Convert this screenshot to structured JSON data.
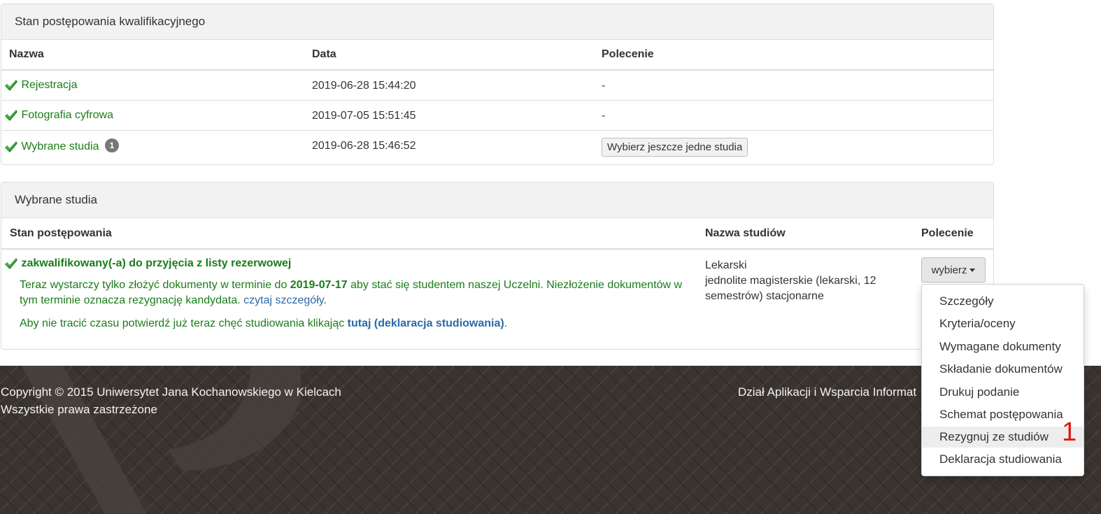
{
  "panel1": {
    "title": "Stan postępowania kwalifikacyjnego",
    "headers": {
      "name": "Nazwa",
      "date": "Data",
      "command": "Polecenie"
    },
    "rows": [
      {
        "name": "Rejestracja",
        "date": "2019-06-28 15:44:20",
        "command": "-"
      },
      {
        "name": "Fotografia cyfrowa",
        "date": "2019-07-05 15:51:45",
        "command": "-"
      },
      {
        "name": "Wybrane studia",
        "badge": "1",
        "date": "2019-06-28 15:46:52",
        "command_button": "Wybierz jeszcze jedne studia"
      }
    ]
  },
  "panel2": {
    "title": "Wybrane studia",
    "headers": {
      "status": "Stan postępowania",
      "study_name": "Nazwa studiów",
      "command": "Polecenie"
    },
    "status_title": "zakwalifikowany(-a) do przyjęcia z listy rezerwowej",
    "msg1_before": "Teraz wystarczy tylko złożyć dokumenty w terminie do ",
    "msg1_date": "2019-07-17",
    "msg1_after": " aby stać się studentem naszej Uczelni. Niezłożenie dokumentów w tym terminie oznacza rezygnację kandydata. ",
    "msg1_link": "czytaj szczegóły",
    "msg2_before": "Aby nie tracić czasu potwierdź już teraz chęć studiowania klikając ",
    "msg2_link": "tutaj (deklaracja studiowania)",
    "study_line1": "Lekarski",
    "study_line2": "jednolite magisterskie (lekarski, 12 semestrów) stacjonarne",
    "select_button": "wybierz"
  },
  "dropdown": {
    "items": [
      "Szczegóły",
      "Kryteria/oceny",
      "Wymagane dokumenty",
      "Składanie dokumentów",
      "Drukuj podanie",
      "Schemat postępowania",
      "Rezygnuj ze studiów",
      "Deklaracja studiowania"
    ],
    "active_index": 6
  },
  "annotation": "1",
  "footer": {
    "copyright_line1": "Copyright © 2015 Uniwersytet Jana Kochanowskiego w Kielcach",
    "copyright_line2": "Wszystkie prawa zastrzeżone",
    "department": "Dział Aplikacji i Wsparcia Informat"
  },
  "colors": {
    "green": "#1a7d1a",
    "link": "#2a6aa8",
    "footer_bg": "#3a3430",
    "annotation": "#e01818"
  }
}
